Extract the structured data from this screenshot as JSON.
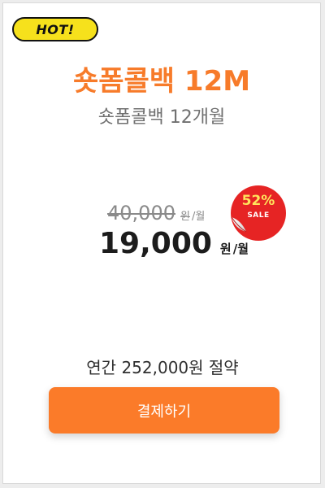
{
  "badge": {
    "label": "HOT!"
  },
  "plan": {
    "title": "숏폼콜백 12M",
    "subtitle": "숏폼콜백 12개월"
  },
  "price": {
    "original": "40,000",
    "original_unit": "원",
    "original_period": "/월",
    "sale": "19,000",
    "sale_unit": "원",
    "sale_period": "/월"
  },
  "discount": {
    "percent": "52%",
    "label": "SALE"
  },
  "savings": {
    "text": "연간 252,000원 절약"
  },
  "pay_button": {
    "label": "결제하기"
  },
  "colors": {
    "accent": "#f77b2a",
    "button": "#fb7b29",
    "badge_bg": "#f6e11c",
    "sticker": "#e62424",
    "sticker_percent": "#ffe45c"
  }
}
